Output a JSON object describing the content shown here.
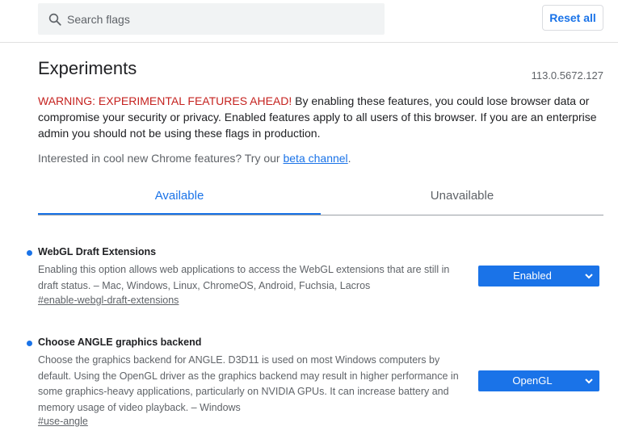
{
  "search": {
    "placeholder": "Search flags",
    "icon": "search-icon"
  },
  "toolbar": {
    "reset_label": "Reset all"
  },
  "header": {
    "title": "Experiments",
    "version": "113.0.5672.127"
  },
  "warning": {
    "emphasis": "WARNING: EXPERIMENTAL FEATURES AHEAD!",
    "body": " By enabling these features, you could lose browser data or compromise your security or privacy. Enabled features apply to all users of this browser. If you are an enterprise admin you should not be using these flags in production."
  },
  "interest": {
    "text": "Interested in cool new Chrome features? Try our ",
    "link_label": "beta channel",
    "suffix": "."
  },
  "tabs": [
    {
      "label": "Available",
      "active": true
    },
    {
      "label": "Unavailable",
      "active": false
    }
  ],
  "experiments": [
    {
      "name": "WebGL Draft Extensions",
      "description": "Enabling this option allows web applications to access the WebGL extensions that are still in draft status. – Mac, Windows, Linux, ChromeOS, Android, Fuchsia, Lacros",
      "link": "#enable-webgl-draft-extensions",
      "value": "Enabled"
    },
    {
      "name": "Choose ANGLE graphics backend",
      "description": "Choose the graphics backend for ANGLE. D3D11 is used on most Windows computers by default. Using the OpenGL driver as the graphics backend may result in higher performance in some graphics-heavy applications, particularly on NVIDIA GPUs. It can increase battery and memory usage of video playback. – Windows",
      "link": "#use-angle",
      "value": "OpenGL"
    }
  ],
  "colors": {
    "accent": "#1a73e8",
    "warning": "#c5221f",
    "text": "#202124",
    "secondary_text": "#5f6368"
  }
}
